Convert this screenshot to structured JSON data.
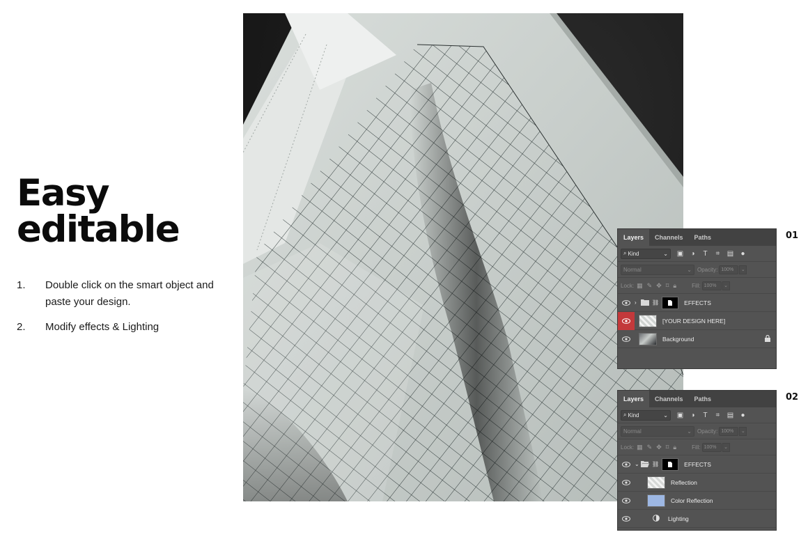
{
  "headline": {
    "line1": "Easy",
    "line2": "editable"
  },
  "steps": [
    {
      "num": "1.",
      "text": "Double click on the smart object and paste your design."
    },
    {
      "num": "2.",
      "text": "Modify effects & Lighting"
    }
  ],
  "panel_numbers": [
    "01",
    "02"
  ],
  "panels": [
    {
      "tabs": [
        "Layers",
        "Channels",
        "Paths"
      ],
      "active_tab": "Layers",
      "filter_kind": "Kind",
      "blend_mode": "Normal",
      "opacity_label": "Opacity:",
      "opacity_value": "100%",
      "lock_label": "Lock:",
      "fill_label": "Fill:",
      "fill_value": "100%",
      "layers": [
        {
          "name": "EFFECTS"
        },
        {
          "name": "[YOUR DESIGN HERE]"
        },
        {
          "name": "Background"
        }
      ]
    },
    {
      "tabs": [
        "Layers",
        "Channels",
        "Paths"
      ],
      "active_tab": "Layers",
      "filter_kind": "Kind",
      "blend_mode": "Normal",
      "opacity_label": "Opacity:",
      "opacity_value": "100%",
      "lock_label": "Lock:",
      "fill_label": "Fill:",
      "fill_value": "100%",
      "layers": [
        {
          "name": "EFFECTS"
        },
        {
          "name": "Reflection"
        },
        {
          "name": "Color Reflection"
        },
        {
          "name": "Lighting"
        }
      ]
    }
  ],
  "colors": {
    "panel_bg": "#535353",
    "tab_bar": "#424242",
    "eye_active": "#c3393b",
    "color_reflection_fill": "#9db7e3",
    "grid_line": "#1f2a2a"
  }
}
